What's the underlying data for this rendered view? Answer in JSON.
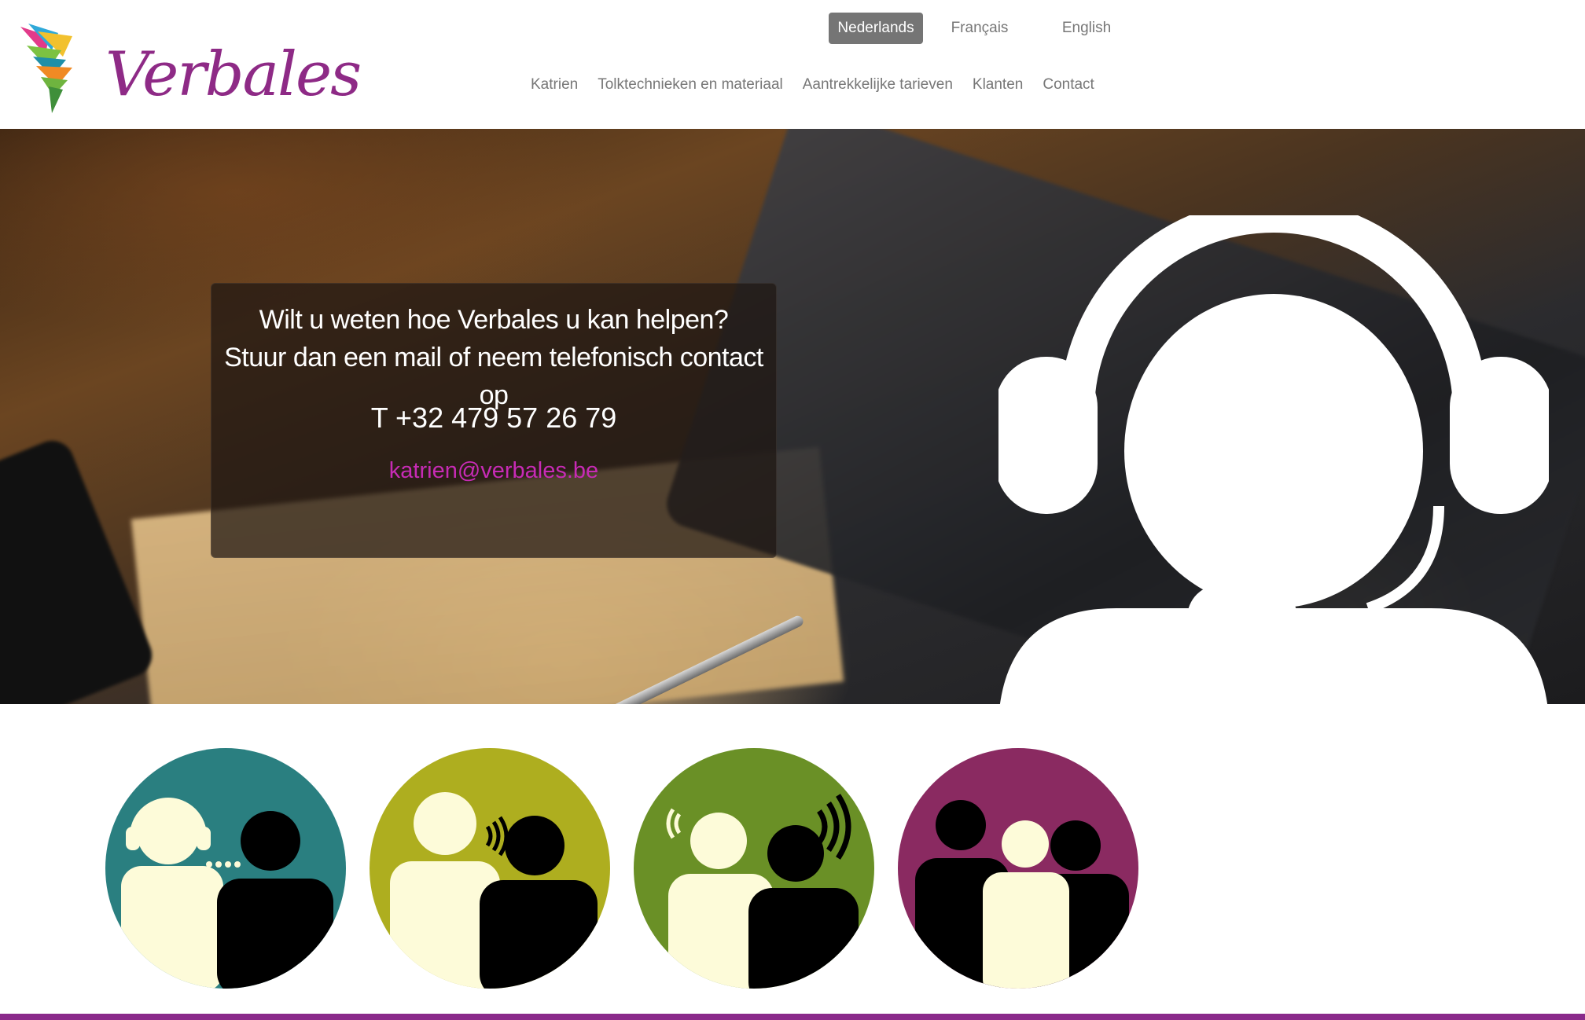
{
  "brand": {
    "name": "Verbales"
  },
  "languages": [
    {
      "label": "Nederlands",
      "active": true
    },
    {
      "label": "Français",
      "active": false
    },
    {
      "label": "English",
      "active": false
    }
  ],
  "nav": {
    "items": [
      {
        "label": "Katrien"
      },
      {
        "label": "Tolktechnieken en materiaal"
      },
      {
        "label": "Aantrekkelijke tarieven"
      },
      {
        "label": "Klanten"
      },
      {
        "label": "Contact"
      }
    ]
  },
  "hero": {
    "line1": "Wilt u weten hoe Verbales u kan helpen?",
    "line2": "Stuur dan een mail of neem telefonisch contact op",
    "phone": "T +32 479 57 26 79",
    "email": "katrien@verbales.be"
  },
  "services": [
    {
      "icon": "interpreter-headset-icon",
      "color": "#2a7f80"
    },
    {
      "icon": "whispering-interpreter-icon",
      "color": "#aeae1f"
    },
    {
      "icon": "liaison-interpreter-icon",
      "color": "#6a9026"
    },
    {
      "icon": "group-meeting-icon",
      "color": "#8a2a61"
    }
  ],
  "colors": {
    "brand_purple": "#8e2a86",
    "email_link": "#c72bb5",
    "active_language_bg": "#757575",
    "footer_bar": "#8a2a8a"
  }
}
